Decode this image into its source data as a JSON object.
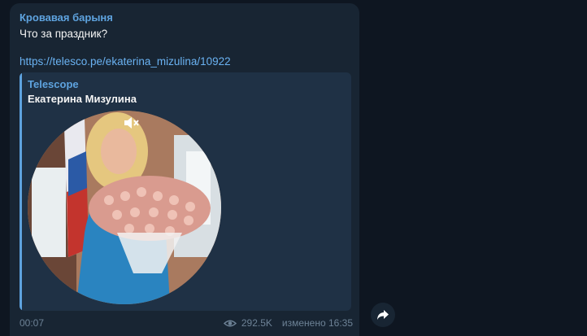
{
  "message": {
    "sender": "Кровавая барыня",
    "text": "Что за праздник?",
    "link": "https://telesco.pe/ekaterina_mizulina/10922"
  },
  "preview": {
    "site_name": "Telescope",
    "title": "Екатерина Мизулина",
    "icons": {
      "mute": "speaker-muted-icon"
    }
  },
  "footer": {
    "duration": "00:07",
    "views": "292.5K",
    "edited_time": "изменено 16:35",
    "icons": {
      "views": "eye-icon"
    }
  },
  "share": {
    "icon": "share-arrow-icon"
  },
  "colors": {
    "background": "#0e1621",
    "bubble": "#182533",
    "accent": "#5ea3df",
    "link": "#6ab2f2"
  }
}
